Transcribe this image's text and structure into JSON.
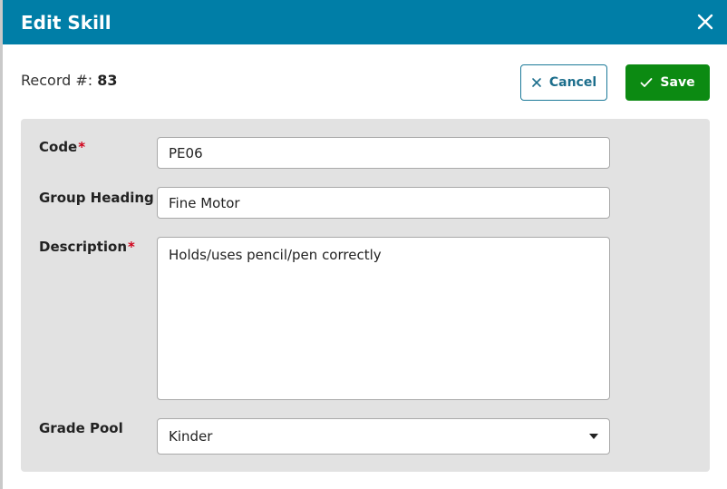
{
  "dialog": {
    "title": "Edit Skill",
    "close_icon": "close-icon"
  },
  "record": {
    "label": "Record #:",
    "number": "83"
  },
  "actions": {
    "cancel_label": "Cancel",
    "save_label": "Save"
  },
  "form": {
    "code": {
      "label": "Code",
      "required": "*",
      "value": "PE06"
    },
    "group_heading": {
      "label": "Group Heading",
      "value": "Fine Motor"
    },
    "description": {
      "label": "Description",
      "required": "*",
      "value": "Holds/uses pencil/pen correctly"
    },
    "grade_pool": {
      "label": "Grade Pool",
      "selected": "Kinder"
    }
  },
  "colors": {
    "header": "#007ea7",
    "save": "#0c8a12",
    "cancel_text": "#1c6e8c",
    "required": "#d0021b",
    "panel": "#e2e2e2"
  }
}
